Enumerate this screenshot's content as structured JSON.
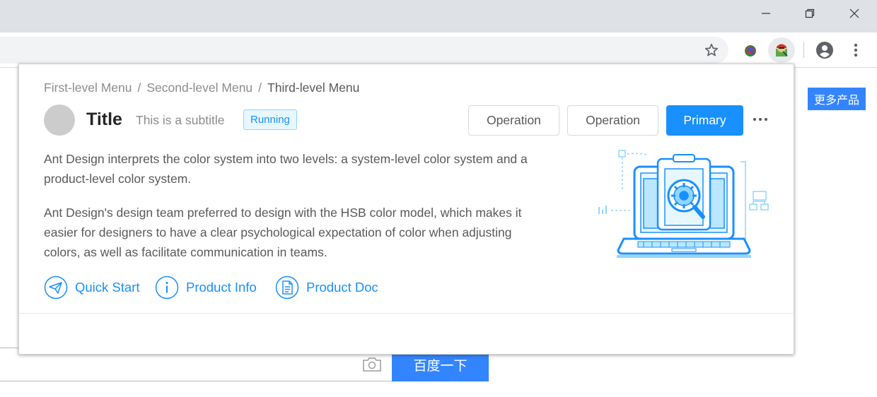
{
  "window": {
    "controls": [
      "minimize-icon",
      "restore-icon",
      "close-icon"
    ]
  },
  "toolbar": {
    "icons": [
      "star-icon",
      "extension-icon",
      "active-extension-icon",
      "account-icon",
      "menu-dots-icon"
    ]
  },
  "page": {
    "more_products_label": "更多产品",
    "search_button_label": "百度一下"
  },
  "popup": {
    "breadcrumb": [
      "First-level Menu",
      "Second-level Menu",
      "Third-level Menu"
    ],
    "title": "Title",
    "subtitle": "This is a subtitle",
    "tag": "Running",
    "actions": {
      "operation_1": "Operation",
      "operation_2": "Operation",
      "primary": "Primary"
    },
    "paragraphs": [
      "Ant Design interprets the color system into two levels: a system-level color system and a product-level color system.",
      "Ant Design's design team preferred to design with the HSB color model, which makes it easier for designers to have a clear psychological expectation of color when adjusting colors, as well as facilitate communication in teams."
    ],
    "links": [
      {
        "label": "Quick Start",
        "icon": "paper-plane-icon"
      },
      {
        "label": "Product Info",
        "icon": "info-circle-icon"
      },
      {
        "label": "Product Doc",
        "icon": "document-icon"
      }
    ]
  },
  "colors": {
    "primary": "#1890ff",
    "baidu_blue": "#3385ff",
    "tag_border": "#91d5ff",
    "tag_background": "#e6f7ff",
    "titlebar": "#dee1e6"
  }
}
